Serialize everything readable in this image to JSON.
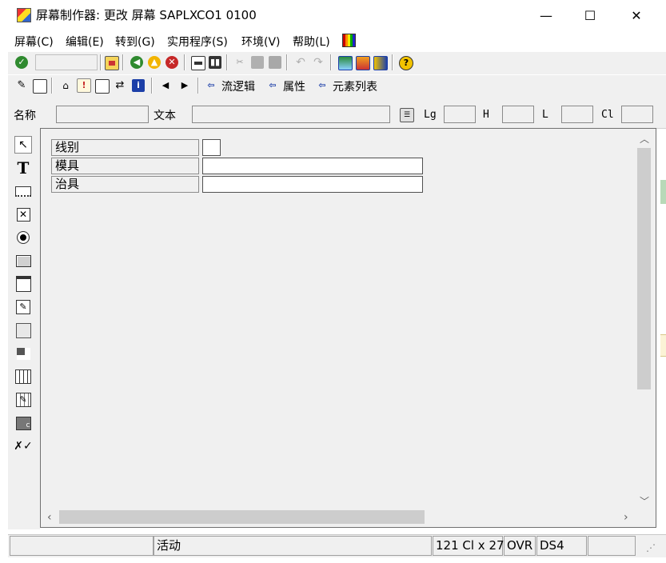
{
  "window": {
    "title": "屏幕制作器:  更改 屏幕 SAPLXCO1 0100",
    "minimize_glyph": "—",
    "maximize_glyph": "☐",
    "close_glyph": "✕"
  },
  "menu": {
    "items": [
      "屏幕(C)",
      "编辑(E)",
      "转到(G)",
      "实用程序(S)",
      "环境(V)",
      "帮助(L)"
    ]
  },
  "toolbar1": {
    "icons": [
      "check-icon",
      "save-icon",
      "back-icon",
      "exit-icon",
      "cancel-icon",
      "print-icon",
      "find-icon",
      "cut-icon",
      "copy-icon",
      "paste-icon",
      "undo-icon",
      "redo-icon",
      "layout-icon-1",
      "layout-icon-2",
      "layout-icon-3",
      "help-icon"
    ]
  },
  "toolbar2": {
    "flow_logic_label": "流逻辑",
    "attributes_label": "属性",
    "element_list_label": "元素列表"
  },
  "attributes_bar": {
    "name_label": "名称",
    "text_label": "文本",
    "lg_label": "Lg",
    "h_label": "H",
    "l_label": "L",
    "cl_label": "Cl",
    "name_value": "",
    "text_value": "",
    "lg_value": "",
    "h_value": "",
    "l_value": "",
    "cl_value": ""
  },
  "palette": {
    "tools": [
      "pointer-tool",
      "text-field-tool",
      "input-field-tool",
      "checkbox-tool",
      "radio-button-tool",
      "pushbutton-tool",
      "tabstrip-tool",
      "tabstrip-wizard-tool",
      "box-tool",
      "subscreen-tool",
      "table-control-tool",
      "table-control-wizard-tool",
      "custom-control-tool",
      "status-icon-tool"
    ]
  },
  "canvas": {
    "rows": [
      {
        "label": "线别",
        "input": ""
      },
      {
        "label": "模具",
        "input": ""
      },
      {
        "label": "治具",
        "input": ""
      }
    ]
  },
  "status": {
    "mode": "活动",
    "size": "121 Cl x 27",
    "overwrite": "OVR",
    "system": "DS4"
  },
  "colors": {
    "background": "#f0f0f0",
    "accent_blue": "#1c3fa8",
    "ok_green": "#2f8a2f",
    "cancel_red": "#c62828",
    "help_yellow": "#f2c300"
  }
}
